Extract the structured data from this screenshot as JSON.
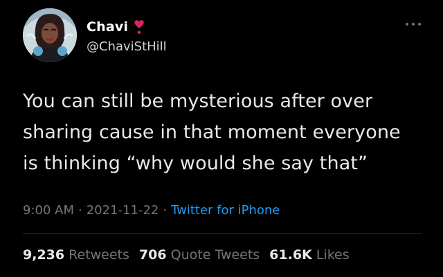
{
  "author": {
    "display_name": "Chavi",
    "handle": "@ChaviStHill",
    "badge_icon": "heart-exclamation-icon"
  },
  "tweet": {
    "lines": [
      "You can still be mysterious after over",
      "sharing cause in that moment everyone",
      "is thinking “why would she say that”"
    ],
    "time": "9:00 AM",
    "date": "2021-11-22",
    "source": "Twitter for iPhone",
    "separator": "·"
  },
  "stats": {
    "retweets_count": "9,236",
    "retweets_label": "Retweets",
    "quotes_count": "706",
    "quotes_label": "Quote Tweets",
    "likes_count": "61.6K",
    "likes_label": "Likes"
  },
  "colors": {
    "background": "#000000",
    "text": "#e7e9ea",
    "muted": "#71767b",
    "link": "#1d9bf0",
    "heart": "#e0245e"
  }
}
